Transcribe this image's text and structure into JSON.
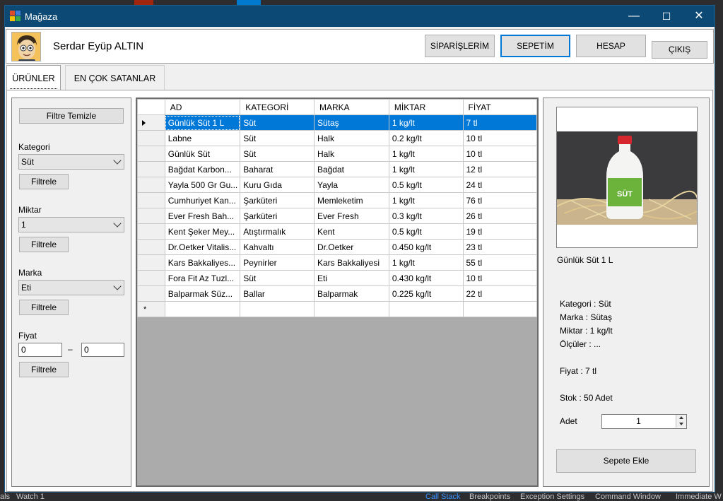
{
  "colors": {
    "titlebar": "#0c4a75",
    "selection": "#0078d7",
    "accent": "#0078d7"
  },
  "ide": {
    "bottom_items": [
      "als",
      "Watch 1",
      "Call Stack",
      "Breakpoints",
      "Exception Settings",
      "Command Window",
      "Immediate W"
    ],
    "active_item": "Call Stack"
  },
  "window": {
    "title": "Mağaza",
    "icon": "store-icon",
    "controls": {
      "minimize": "—",
      "maximize": "☐",
      "close": "✕"
    }
  },
  "header": {
    "avatar_icon": "user-avatar-icon",
    "username": "Serdar Eyüp ALTIN",
    "buttons": {
      "orders": "SİPARİŞLERİM",
      "cart": "SEPETİM",
      "account": "HESAP",
      "exit": "ÇIKIŞ"
    }
  },
  "tabs": [
    "ÜRÜNLER",
    "EN ÇOK SATANLAR"
  ],
  "filters": {
    "clear_label": "Filtre Temizle",
    "category_label": "Kategori",
    "category_value": "Süt",
    "amount_label": "Miktar",
    "amount_value": "1",
    "brand_label": "Marka",
    "brand_value": "Eti",
    "price_label": "Fiyat",
    "price_min": "0",
    "price_dash": "–",
    "price_max": "0",
    "apply_label": "Filtrele"
  },
  "grid": {
    "columns": [
      "AD",
      "KATEGORİ",
      "MARKA",
      "MİKTAR",
      "FİYAT"
    ],
    "rows": [
      [
        "Günlük Süt 1 L",
        "Süt",
        "Sütaş",
        "1 kg/lt",
        "7 tl"
      ],
      [
        "Labne",
        "Süt",
        "Halk",
        "0.2 kg/lt",
        "10 tl"
      ],
      [
        "Günlük Süt",
        "Süt",
        "Halk",
        "1 kg/lt",
        "10 tl"
      ],
      [
        "Bağdat Karbon...",
        "Baharat",
        "Bağdat",
        "1 kg/lt",
        "12 tl"
      ],
      [
        "Yayla 500 Gr Gu...",
        "Kuru Gıda",
        "Yayla",
        "0.5 kg/lt",
        "24 tl"
      ],
      [
        "Cumhuriyet Kan...",
        "Şarküteri",
        "Memleketim",
        "1 kg/lt",
        "76 tl"
      ],
      [
        "Ever Fresh Bah...",
        "Şarküteri",
        "Ever Fresh",
        "0.3 kg/lt",
        "26 tl"
      ],
      [
        "Kent Şeker Mey...",
        "Atıştırmalık",
        "Kent",
        "0.5 kg/lt",
        "19 tl"
      ],
      [
        "Dr.Oetker Vitalis...",
        "Kahvaltı",
        "Dr.Oetker",
        "0.450 kg/lt",
        "23 tl"
      ],
      [
        "Kars Bakkaliyes...",
        "Peynirler",
        "Kars Bakkaliyesi",
        "1 kg/lt",
        "55 tl"
      ],
      [
        "Fora Fit Az Tuzl...",
        "Süt",
        "Eti",
        "0.430 kg/lt",
        "10 tl"
      ],
      [
        "Balparmak Süz...",
        "Ballar",
        "Balparmak",
        "0.225 kg/lt",
        "22 tl"
      ]
    ],
    "selected_row": 0,
    "new_row_marker": "*"
  },
  "detail": {
    "image_icon": "milk-bottle-photo",
    "bottle_label": "SÜT",
    "product_name": "Günlük Süt 1 L",
    "category": "Kategori : Süt",
    "brand": "Marka : Sütaş",
    "amount": "Miktar : 1 kg/lt",
    "dimensions": "Ölçüler : ...",
    "price": "Fiyat : 7 tl",
    "stock": "Stok : 50 Adet",
    "qty_label": "Adet",
    "qty_value": "1",
    "add_button": "Sepete Ekle"
  }
}
